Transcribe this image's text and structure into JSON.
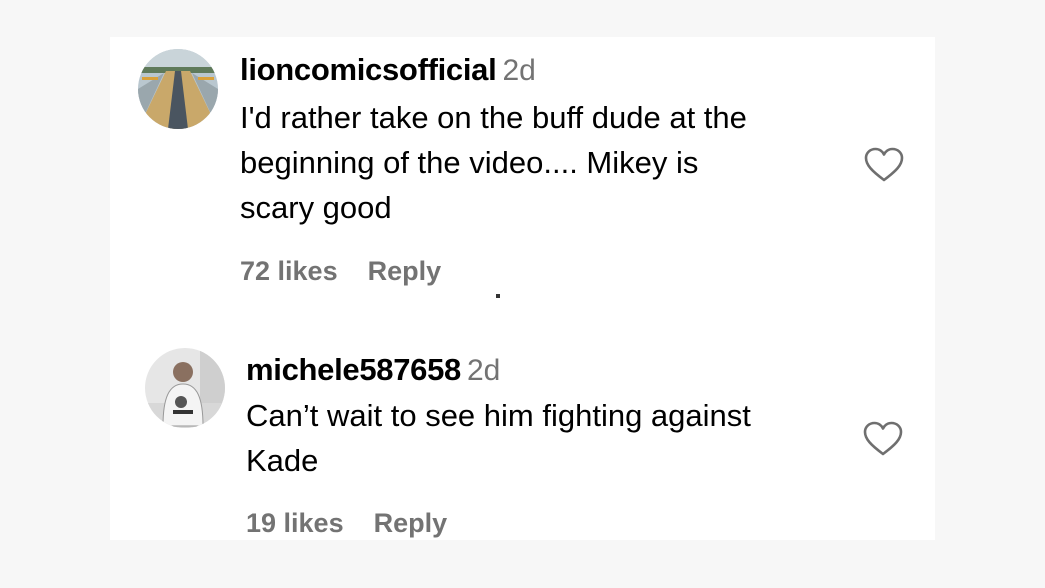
{
  "comments": [
    {
      "username": "lioncomicsofficial",
      "time": "2d",
      "text": "I'd rather take on the buff dude at the\nbeginning of the video.... Mikey is\nscary good",
      "likes": "72 likes",
      "reply_label": "Reply",
      "avatar_icon": "road-photo-avatar",
      "like_icon": "heart-outline-icon"
    },
    {
      "username": "michele587658",
      "time": "2d",
      "text": "Can’t wait to see him fighting against\nKade",
      "likes": "19 likes",
      "reply_label": "Reply",
      "avatar_icon": "person-photo-avatar",
      "like_icon": "heart-outline-icon"
    }
  ],
  "colors": {
    "background": "#f7f7f7",
    "panel": "#ffffff",
    "text": "#000000",
    "secondary_text": "#737373"
  }
}
